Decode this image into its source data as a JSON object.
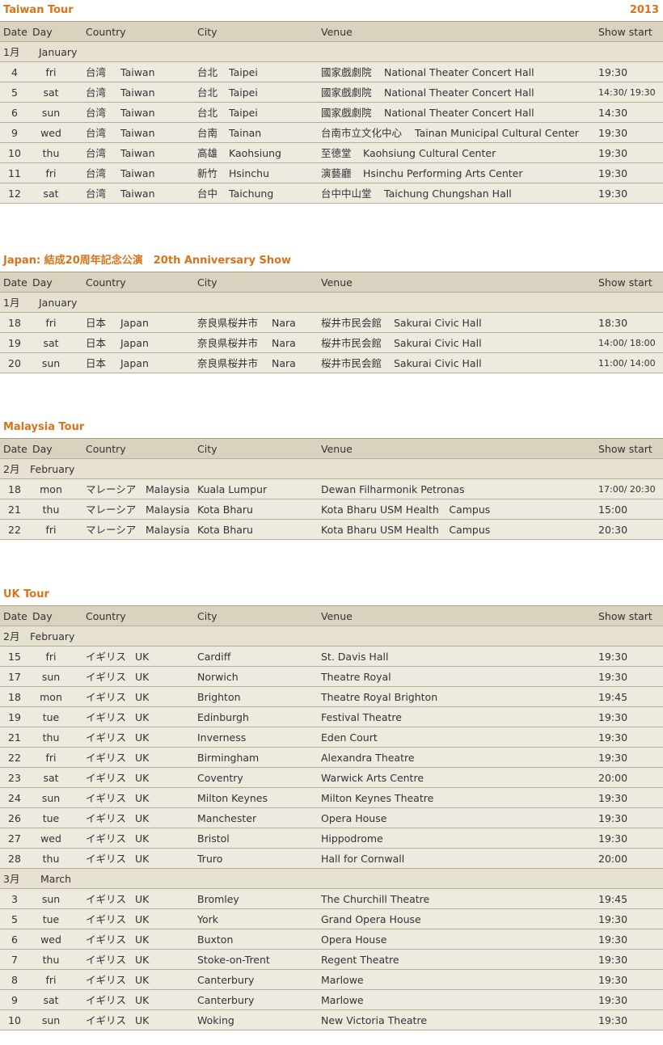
{
  "headers": {
    "date": "Date",
    "day": "Day",
    "country": "Country",
    "city": "City",
    "venue": "Venue",
    "show": "Show start"
  },
  "taiwan": {
    "title": "Taiwan Tour",
    "year": "2013",
    "month": {
      "jp": "1月",
      "en": "January"
    },
    "rows": [
      {
        "date": "4",
        "day": "fri",
        "cjp": "台湾",
        "cen": "Taiwan",
        "cityjp": "台北",
        "cityen": "Taipei",
        "venjp": "國家戲劇院",
        "venen": "National Theater Concert Hall",
        "show": "19:30"
      },
      {
        "date": "5",
        "day": "sat",
        "cjp": "台湾",
        "cen": "Taiwan",
        "cityjp": "台北",
        "cityen": "Taipei",
        "venjp": "國家戲劇院",
        "venen": "National Theater Concert Hall",
        "show": "14:30/ 19:30"
      },
      {
        "date": "6",
        "day": "sun",
        "cjp": "台湾",
        "cen": "Taiwan",
        "cityjp": "台北",
        "cityen": "Taipei",
        "venjp": "國家戲劇院",
        "venen": "National Theater Concert Hall",
        "show": "14:30"
      },
      {
        "date": "9",
        "day": "wed",
        "cjp": "台湾",
        "cen": "Taiwan",
        "cityjp": "台南",
        "cityen": "Tainan",
        "venjp": "台南市立文化中心",
        "venen": "Tainan Municipal Cultural Center",
        "show": "19:30"
      },
      {
        "date": "10",
        "day": "thu",
        "cjp": "台湾",
        "cen": "Taiwan",
        "cityjp": "高雄",
        "cityen": "Kaohsiung",
        "venjp": "至徳堂",
        "venen": "Kaohsiung Cultural Center",
        "show": "19:30"
      },
      {
        "date": "11",
        "day": "fri",
        "cjp": "台湾",
        "cen": "Taiwan",
        "cityjp": "新竹",
        "cityen": "Hsinchu",
        "venjp": "演藝廳",
        "venen": "Hsinchu Performing Arts Center",
        "show": "19:30"
      },
      {
        "date": "12",
        "day": "sat",
        "cjp": "台湾",
        "cen": "Taiwan",
        "cityjp": "台中",
        "cityen": "Taichung",
        "venjp": "台中中山堂",
        "venen": "Taichung Chungshan Hall",
        "show": "19:30"
      }
    ]
  },
  "japan": {
    "title": "Japan: 結成20周年記念公演　20th Anniversary Show",
    "month": {
      "jp": "1月",
      "en": "January"
    },
    "rows": [
      {
        "date": "18",
        "day": "fri",
        "cjp": "日本",
        "cen": "Japan",
        "cityjp": "奈良県桜井市",
        "cityen": "Nara",
        "venjp": "桜井市民会館",
        "venen": "Sakurai Civic Hall",
        "show": "18:30"
      },
      {
        "date": "19",
        "day": "sat",
        "cjp": "日本",
        "cen": "Japan",
        "cityjp": "奈良県桜井市",
        "cityen": "Nara",
        "venjp": "桜井市民会館",
        "venen": "Sakurai Civic Hall",
        "show": "14:00/ 18:00"
      },
      {
        "date": "20",
        "day": "sun",
        "cjp": "日本",
        "cen": "Japan",
        "cityjp": "奈良県桜井市",
        "cityen": "Nara",
        "venjp": "桜井市民会館",
        "venen": "Sakurai Civic Hall",
        "show": "11:00/ 14:00"
      }
    ]
  },
  "malaysia": {
    "title": "Malaysia Tour",
    "month": {
      "jp": "2月",
      "en": "February"
    },
    "rows": [
      {
        "date": "18",
        "day": "mon",
        "cjp": "マレーシア",
        "cen": "Malaysia",
        "city": "Kuala Lumpur",
        "venue": "Dewan Filharmonik Petronas",
        "show": "17:00/ 20:30"
      },
      {
        "date": "21",
        "day": "thu",
        "cjp": "マレーシア",
        "cen": "Malaysia",
        "city": "Kota Bharu",
        "venue": "Kota Bharu USM Health　Campus",
        "show": "15:00"
      },
      {
        "date": "22",
        "day": "fri",
        "cjp": "マレーシア",
        "cen": "Malaysia",
        "city": "Kota Bharu",
        "venue": "Kota Bharu USM Health　Campus",
        "show": "20:30"
      }
    ]
  },
  "uk": {
    "title": "UK Tour",
    "month1": {
      "jp": "2月",
      "en": "February"
    },
    "rows1": [
      {
        "date": "15",
        "day": "fri",
        "cjp": "イギリス",
        "cen": "UK",
        "city": "Cardiff",
        "venue": "St. Davis Hall",
        "show": "19:30"
      },
      {
        "date": "17",
        "day": "sun",
        "cjp": "イギリス",
        "cen": "UK",
        "city": "Norwich",
        "venue": "Theatre Royal",
        "show": "19:30"
      },
      {
        "date": "18",
        "day": "mon",
        "cjp": "イギリス",
        "cen": "UK",
        "city": "Brighton",
        "venue": "Theatre Royal Brighton",
        "show": "19:45"
      },
      {
        "date": "19",
        "day": "tue",
        "cjp": "イギリス",
        "cen": "UK",
        "city": "Edinburgh",
        "venue": "Festival Theatre",
        "show": "19:30"
      },
      {
        "date": "21",
        "day": "thu",
        "cjp": "イギリス",
        "cen": "UK",
        "city": "Inverness",
        "venue": "Eden Court",
        "show": "19:30"
      },
      {
        "date": "22",
        "day": "fri",
        "cjp": "イギリス",
        "cen": "UK",
        "city": "Birmingham",
        "venue": "Alexandra Theatre",
        "show": "19:30"
      },
      {
        "date": "23",
        "day": "sat",
        "cjp": "イギリス",
        "cen": "UK",
        "city": "Coventry",
        "venue": "Warwick Arts Centre",
        "show": "20:00"
      },
      {
        "date": "24",
        "day": "sun",
        "cjp": "イギリス",
        "cen": "UK",
        "city": "Milton Keynes",
        "venue": "Milton Keynes Theatre",
        "show": "19:30"
      },
      {
        "date": "26",
        "day": "tue",
        "cjp": "イギリス",
        "cen": "UK",
        "city": "Manchester",
        "venue": "Opera House",
        "show": "19:30"
      },
      {
        "date": "27",
        "day": "wed",
        "cjp": "イギリス",
        "cen": "UK",
        "city": "Bristol",
        "venue": "Hippodrome",
        "show": "19:30"
      },
      {
        "date": "28",
        "day": "thu",
        "cjp": "イギリス",
        "cen": "UK",
        "city": "Truro",
        "venue": "Hall for Cornwall",
        "show": "20:00"
      }
    ],
    "month2": {
      "jp": "3月",
      "en": "March"
    },
    "rows2": [
      {
        "date": "3",
        "day": "sun",
        "cjp": "イギリス",
        "cen": "UK",
        "city": "Bromley",
        "venue": "The Churchill Theatre",
        "show": "19:45"
      },
      {
        "date": "5",
        "day": "tue",
        "cjp": "イギリス",
        "cen": "UK",
        "city": "York",
        "venue": "Grand Opera House",
        "show": "19:30"
      },
      {
        "date": "6",
        "day": "wed",
        "cjp": "イギリス",
        "cen": "UK",
        "city": "Buxton",
        "venue": "Opera House",
        "show": "19:30"
      },
      {
        "date": "7",
        "day": "thu",
        "cjp": "イギリス",
        "cen": "UK",
        "city": "Stoke-on-Trent",
        "venue": "Regent Theatre",
        "show": "19:30"
      },
      {
        "date": "8",
        "day": "fri",
        "cjp": "イギリス",
        "cen": "UK",
        "city": "Canterbury",
        "venue": "Marlowe",
        "show": "19:30"
      },
      {
        "date": "9",
        "day": "sat",
        "cjp": "イギリス",
        "cen": "UK",
        "city": "Canterbury",
        "venue": "Marlowe",
        "show": "19:30"
      },
      {
        "date": "10",
        "day": "sun",
        "cjp": "イギリス",
        "cen": "UK",
        "city": "Woking",
        "venue": "New Victoria Theatre",
        "show": "19:30"
      }
    ]
  }
}
